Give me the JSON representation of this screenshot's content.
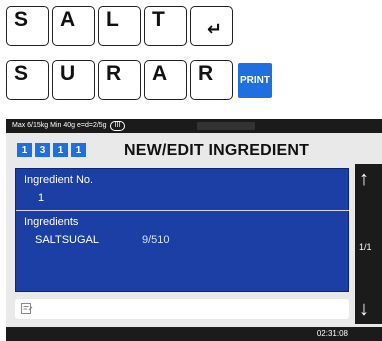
{
  "keyboard": {
    "row1": [
      "S",
      "A",
      "L",
      "T"
    ],
    "enter_glyph": "↵",
    "row2": [
      "S",
      "U",
      "R",
      "A",
      "R"
    ],
    "print_label": "PRINT"
  },
  "screen": {
    "status": {
      "capacity": "Max 6/15kg Min 40g e=d=2/5g",
      "class": "III"
    },
    "codes": [
      "1",
      "3",
      "1",
      "1"
    ],
    "title": "NEW/EDIT INGREDIENT",
    "fields": {
      "ingredient_no_label": "Ingredient No.",
      "ingredient_no_value": "1",
      "ingredients_label": "Ingredients",
      "ingredients_text": "SALTSUGAL",
      "ingredients_count": "9/510"
    },
    "input_icon": "note-icon",
    "side": {
      "up_icon": "arrow-up-icon",
      "page": "1/1",
      "down_icon": "arrow-down-icon"
    },
    "time": "02:31:08"
  }
}
